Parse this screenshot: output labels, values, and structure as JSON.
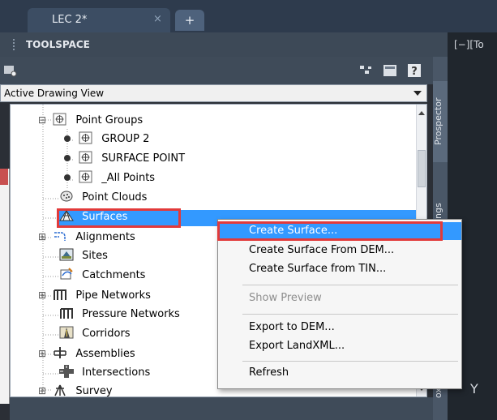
{
  "tabbar": {
    "doc_tab": "LEC 2*",
    "close_glyph": "×",
    "new_tab_glyph": "+"
  },
  "toolspace": {
    "title": "TOOLSPACE",
    "help_glyph": "?",
    "view_dropdown": "Active Drawing View"
  },
  "viewport": {
    "label": "[−][To",
    "axis_label": "Y"
  },
  "side_tabs": {
    "prospector": "Prospector",
    "settings_partial": "ngs",
    "toolbox_partial": "ox"
  },
  "tree": [
    {
      "label": "Point Groups",
      "icon": "point-group-icon",
      "expander": "⊟"
    },
    {
      "label": "GROUP 2",
      "icon": "point-group-icon"
    },
    {
      "label": "SURFACE POINT",
      "icon": "point-group-icon"
    },
    {
      "label": "_All Points",
      "icon": "point-group-icon"
    },
    {
      "label": "Point Clouds",
      "icon": "point-cloud-icon"
    },
    {
      "label": "Surfaces",
      "icon": "surface-icon"
    },
    {
      "label": "Alignments",
      "icon": "alignment-icon",
      "expander": "⊞"
    },
    {
      "label": "Sites",
      "icon": "sites-icon"
    },
    {
      "label": "Catchments",
      "icon": "catchment-icon"
    },
    {
      "label": "Pipe Networks",
      "icon": "pipe-network-icon",
      "expander": "⊞"
    },
    {
      "label": "Pressure Networks",
      "icon": "pressure-network-icon"
    },
    {
      "label": "Corridors",
      "icon": "corridor-icon"
    },
    {
      "label": "Assemblies",
      "icon": "assembly-icon",
      "expander": "⊞"
    },
    {
      "label": "Intersections",
      "icon": "intersection-icon"
    },
    {
      "label": "Survey",
      "icon": "survey-icon",
      "expander": "⊞"
    }
  ],
  "context_menu": {
    "items": [
      "Create Surface...",
      "Create Surface From DEM...",
      "Create Surface from TIN...",
      "Show Preview",
      "Export to DEM...",
      "Export LandXML...",
      "Refresh"
    ]
  },
  "colors": {
    "highlight": "#3399ff",
    "annotation_red": "#e23a3a",
    "panel_dark": "#3d4957"
  }
}
